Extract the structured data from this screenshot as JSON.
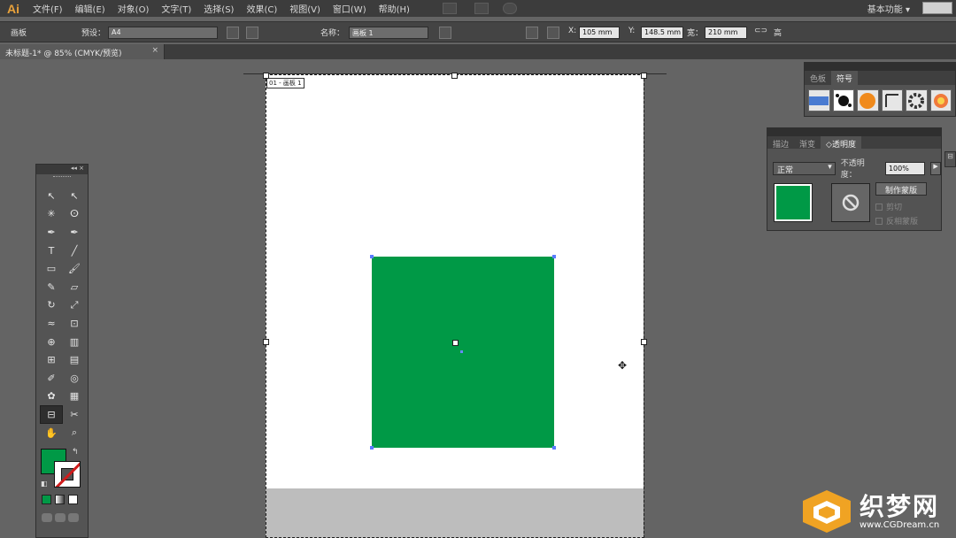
{
  "app": {
    "logo": "Ai"
  },
  "menu": [
    "文件(F)",
    "编辑(E)",
    "对象(O)",
    "文字(T)",
    "选择(S)",
    "效果(C)",
    "视图(V)",
    "窗口(W)",
    "帮助(H)"
  ],
  "workspace": "基本功能 ▾",
  "control": {
    "tool_name": "画板",
    "preset_label": "预设：",
    "preset_value": "A4",
    "name_label": "名称：",
    "name_value": "画板 1",
    "x_label": "X:",
    "x_value": "105 mm",
    "y_label": "Y:",
    "y_value": "148.5 mm",
    "w_label": "宽：",
    "w_value": "210 mm",
    "h_label": "高"
  },
  "document": {
    "tab_title": "未标题-1* @ 85% (CMYK/预览)",
    "close": "×"
  },
  "artboard": {
    "label": "01 - 画板 1"
  },
  "colors": {
    "fill": "#009946",
    "accent_handle": "#5b7bff",
    "logo": "#e9a23b"
  },
  "toolbox": {
    "header": "◂◂ ×",
    "tools": [
      "selection-tool",
      "direct-selection-tool",
      "magic-wand-tool",
      "lasso-tool",
      "pen-tool",
      "curvature-tool",
      "type-tool",
      "line-tool",
      "rectangle-tool",
      "paintbrush-tool",
      "pencil-tool",
      "eraser-tool",
      "rotate-tool",
      "scale-tool",
      "warp-tool",
      "free-transform-tool",
      "shape-builder-tool",
      "chart-tool",
      "mesh-tool",
      "gradient-tool",
      "eyedropper-tool",
      "blend-tool",
      "symbol-sprayer-tool",
      "column-graph-tool",
      "artboard-tool",
      "slice-tool",
      "hand-tool",
      "zoom-tool"
    ],
    "glyphs": [
      "↖",
      "↖",
      "✳",
      "ⵙ",
      "✒",
      "✒",
      "T",
      "╱",
      "▭",
      "🖌",
      "✎",
      "▱",
      "↻",
      "⤢",
      "≈",
      "⊡",
      "⊕",
      "▥",
      "⊞",
      "▤",
      "✐",
      "◎",
      "✿",
      "▦",
      "⊟",
      "✂",
      "✋",
      "⌕"
    ]
  },
  "symbol_panel": {
    "tabs": [
      "色板",
      "符号"
    ],
    "active": "符号"
  },
  "transparency_panel": {
    "tabs": [
      "描边",
      "渐变",
      "◇透明度"
    ],
    "blend_mode": "正常",
    "opacity_label": "不透明度：",
    "opacity_value": "100%",
    "make_mask": "制作蒙版",
    "clip_label": "剪切",
    "invert_label": "反相蒙版"
  },
  "watermark": {
    "title": "织梦网",
    "url": "www.CGDream.cn"
  }
}
